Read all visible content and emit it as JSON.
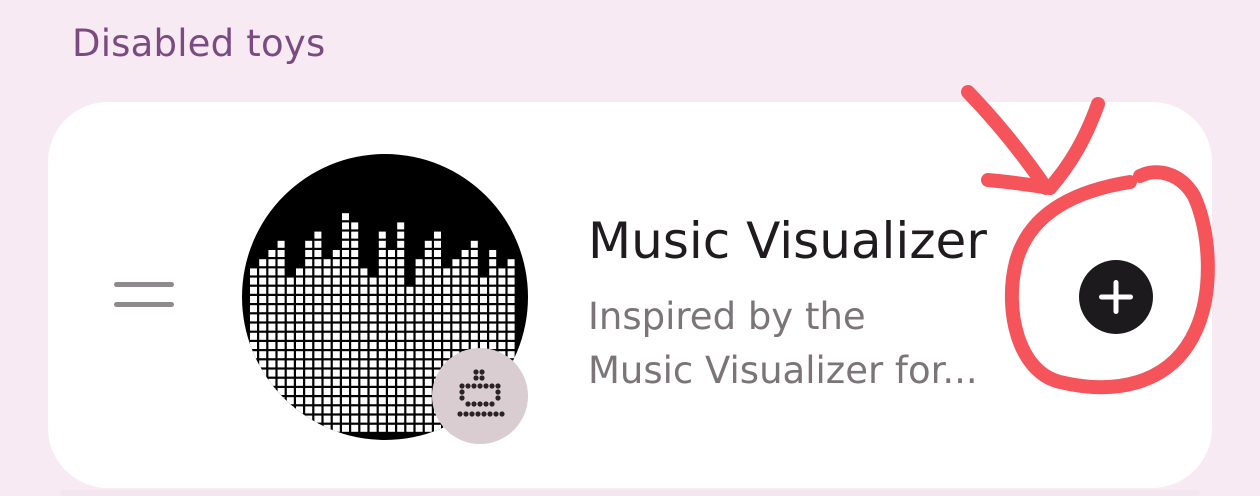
{
  "section": {
    "title": "Disabled toys"
  },
  "toy": {
    "title": "Music Visualizer",
    "description_line1": "Inspired by the",
    "description_line2": "Music Visualizer for..."
  },
  "icons": {
    "drag": "drag-handle-icon",
    "toy": "music-visualizer-icon",
    "badge": "robot-icon",
    "add": "add-icon"
  },
  "colors": {
    "background": "#f8eaf3",
    "section_title": "#7a4b80",
    "card": "#ffffff",
    "add_button": "#1d1a1d",
    "annotation": "#f4545a"
  }
}
